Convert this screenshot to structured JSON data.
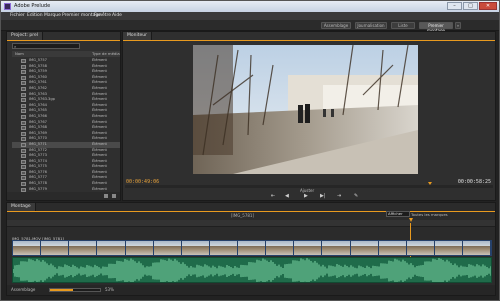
{
  "window": {
    "title": "Adobe Prelude"
  },
  "menu": [
    "Fichier",
    "Edition",
    "Marque",
    "Premier montage",
    "Fenêtre",
    "Aide"
  ],
  "workspaces": [
    {
      "label": "Assemblage",
      "active": false
    },
    {
      "label": "Journalisation",
      "active": false
    },
    {
      "label": "Liste",
      "active": false
    },
    {
      "label": "Premier montage",
      "active": true
    }
  ],
  "project": {
    "tab": "Project: prel",
    "search_value": "",
    "columns": {
      "name": "Nom",
      "type": "Type de média"
    },
    "rows": [
      {
        "name": "IMG_5757",
        "type": "Élément"
      },
      {
        "name": "IMG_5758",
        "type": "Élément"
      },
      {
        "name": "IMG_5759",
        "type": "Élément"
      },
      {
        "name": "IMG_5760",
        "type": "Élément"
      },
      {
        "name": "IMG_5761",
        "type": "Élément"
      },
      {
        "name": "IMG_5762",
        "type": "Élément"
      },
      {
        "name": "IMG_5763",
        "type": "Élément"
      },
      {
        "name": "IMG_5763.3gp",
        "type": "Élément"
      },
      {
        "name": "IMG_5764",
        "type": "Élément"
      },
      {
        "name": "IMG_5765",
        "type": "Élément"
      },
      {
        "name": "IMG_5766",
        "type": "Élément"
      },
      {
        "name": "IMG_5767",
        "type": "Élément"
      },
      {
        "name": "IMG_5768",
        "type": "Élément"
      },
      {
        "name": "IMG_5769",
        "type": "Élément"
      },
      {
        "name": "IMG_5770",
        "type": "Élément"
      },
      {
        "name": "IMG_5771",
        "type": "Élément"
      },
      {
        "name": "IMG_5772",
        "type": "Élément"
      },
      {
        "name": "IMG_5773",
        "type": "Élément"
      },
      {
        "name": "IMG_5774",
        "type": "Élément"
      },
      {
        "name": "IMG_5775",
        "type": "Élément"
      },
      {
        "name": "IMG_5776",
        "type": "Élément"
      },
      {
        "name": "IMG_5777",
        "type": "Élément"
      },
      {
        "name": "IMG_5778",
        "type": "Élément"
      },
      {
        "name": "IMG_5779",
        "type": "Élément"
      }
    ],
    "selected_index": 15
  },
  "monitor": {
    "tab": "Moniteur",
    "timecode_in": "00:00:49:06",
    "timecode_out": "00:00:58:25",
    "adjust_label": "Ajuster",
    "playhead_fraction": 0.83
  },
  "timeline": {
    "tab": "Montage",
    "clip_title": "[IMG_5781]",
    "clip_name": "IMG_5781.MOV [IMG_5781]",
    "view_label": "Afficher",
    "marks_label": "Toutes les marques",
    "zoom_label": "Assemblage",
    "zoom_value": "53%",
    "volume_fraction": 0.45,
    "thumbnail_count": 17
  },
  "colors": {
    "accent": "#e89a1f",
    "video_track": "#3b5a8a",
    "audio_track": "#1f6b4a"
  },
  "icons": [
    "app-icon",
    "minimize-icon",
    "maximize-icon",
    "close-icon",
    "search-icon",
    "clip-icon",
    "new-bin-icon",
    "delete-icon",
    "step-back-icon",
    "play-icon",
    "step-forward-icon",
    "loop-icon",
    "settings-icon"
  ]
}
